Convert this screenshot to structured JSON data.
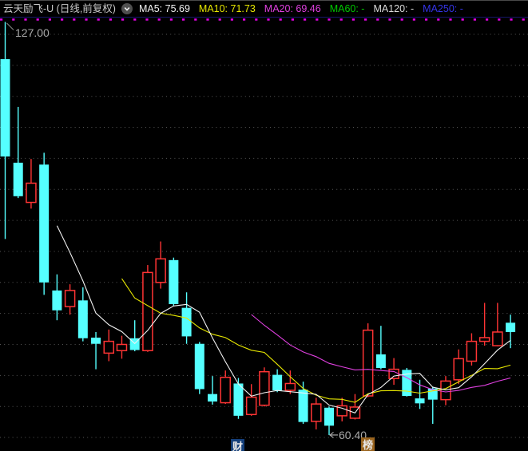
{
  "header": {
    "title": "云天励飞-U (日线,前复权)",
    "dropdown_icon": "chevron-down",
    "indicators": [
      {
        "id": "ma5",
        "label": "MA5:",
        "value": "75.69",
        "color": "#f2f2f2"
      },
      {
        "id": "ma10",
        "label": "MA10:",
        "value": "71.73",
        "color": "#e8e800"
      },
      {
        "id": "ma20",
        "label": "MA20:",
        "value": "69.46",
        "color": "#e040e0"
      },
      {
        "id": "ma60",
        "label": "MA60:",
        "value": "-",
        "color": "#00c800"
      },
      {
        "id": "ma120",
        "label": "MA120:",
        "value": "-",
        "color": "#dcdcdc"
      },
      {
        "id": "ma250",
        "label": "MA250:",
        "value": "-",
        "color": "#3434e8"
      }
    ]
  },
  "chart_data": {
    "type": "candlestick",
    "title": "云天励飞-U 日线 前复权",
    "ylabel": "价格",
    "ylim": [
      57.7,
      127.6
    ],
    "x_axis": {
      "bars": 40,
      "labels_visible": false
    },
    "grid": {
      "top_price": 125,
      "bottom_price": 60,
      "step": 5,
      "color": "#565656"
    },
    "up_color": "#ff3434",
    "down_color": "#55ffff",
    "annotation_color": "#a8a8a8",
    "top_dotted_line": {
      "color": "#e800e8"
    },
    "high_label": {
      "text": "127.00",
      "price": 127.0,
      "bar": 1
    },
    "low_label": {
      "text": "60.40",
      "price": 60.4,
      "bar": 26
    },
    "ma_lines": [
      {
        "period": 5,
        "color": "#f2f2f2"
      },
      {
        "period": 10,
        "color": "#e8e800"
      },
      {
        "period": 20,
        "color": "#e040e0"
      }
    ],
    "candles_format": [
      "open",
      "high",
      "low",
      "close"
    ],
    "candles": [
      [
        121.0,
        127.0,
        92.0,
        105.3
      ],
      [
        104.3,
        113.3,
        98.6,
        98.9
      ],
      [
        97.9,
        104.9,
        96.9,
        101.0
      ],
      [
        104.0,
        105.9,
        83.0,
        85.0
      ],
      [
        83.7,
        86.3,
        78.9,
        80.5
      ],
      [
        81.1,
        84.7,
        79.8,
        83.7
      ],
      [
        82.1,
        84.2,
        75.5,
        76.0
      ],
      [
        76.1,
        77.0,
        71.0,
        75.1
      ],
      [
        73.6,
        77.4,
        72.3,
        75.5
      ],
      [
        74.0,
        76.4,
        72.7,
        75.0
      ],
      [
        76.0,
        78.9,
        73.9,
        74.1
      ],
      [
        74.0,
        87.8,
        73.8,
        86.6
      ],
      [
        85.0,
        91.6,
        84.0,
        88.8
      ],
      [
        88.6,
        89.0,
        81.2,
        81.5
      ],
      [
        80.9,
        83.4,
        75.1,
        76.3
      ],
      [
        75.1,
        75.4,
        67.0,
        67.8
      ],
      [
        67.0,
        69.9,
        65.3,
        65.8
      ],
      [
        65.6,
        70.8,
        65.4,
        69.7
      ],
      [
        68.7,
        69.6,
        63.0,
        63.5
      ],
      [
        63.7,
        68.6,
        63.5,
        66.5
      ],
      [
        65.2,
        71.3,
        65.0,
        70.6
      ],
      [
        70.1,
        71.0,
        67.3,
        67.6
      ],
      [
        67.6,
        70.8,
        67.0,
        68.7
      ],
      [
        67.7,
        69.0,
        62.2,
        62.5
      ],
      [
        62.6,
        66.4,
        61.3,
        65.4
      ],
      [
        64.8,
        65.0,
        60.4,
        61.9
      ],
      [
        63.5,
        66.4,
        62.6,
        65.1
      ],
      [
        63.1,
        67.0,
        62.9,
        64.9
      ],
      [
        66.7,
        78.4,
        66.5,
        77.3
      ],
      [
        73.4,
        78.0,
        71.0,
        71.2
      ],
      [
        69.5,
        72.8,
        68.5,
        71.0
      ],
      [
        70.9,
        71.2,
        66.6,
        66.7
      ],
      [
        66.3,
        69.3,
        64.6,
        65.5
      ],
      [
        67.9,
        68.2,
        62.2,
        66.1
      ],
      [
        66.1,
        69.9,
        65.2,
        69.1
      ],
      [
        69.3,
        74.2,
        68.6,
        72.7
      ],
      [
        72.3,
        76.8,
        71.6,
        75.5
      ],
      [
        75.5,
        81.7,
        74.8,
        76.1
      ],
      [
        74.8,
        81.7,
        74.7,
        77.0
      ],
      [
        78.5,
        79.8,
        74.4,
        77.0
      ]
    ]
  },
  "watermarks": [
    {
      "text": "财"
    },
    {
      "text": "榜"
    }
  ]
}
